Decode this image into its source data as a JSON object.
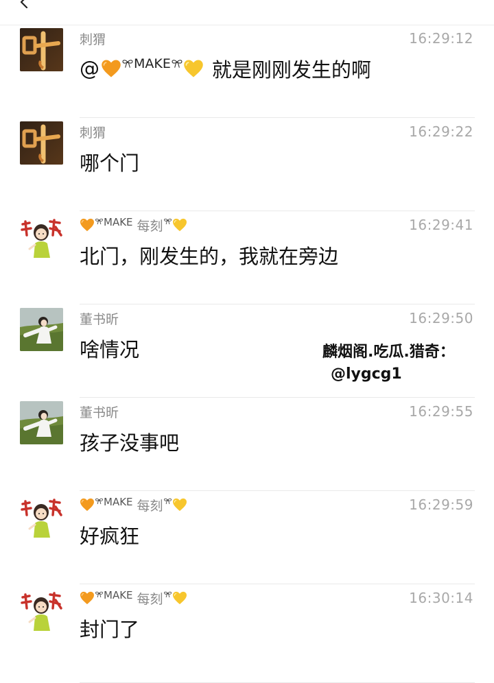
{
  "watermark": {
    "line1": "麟烟阁.吃瓜.猎奇：",
    "line2": "@lygcg1"
  },
  "colors": {
    "orange_heart": "#f39a1e",
    "yellow_heart": "#f7c62d",
    "time_gray": "#a8a8a8",
    "name_gray": "#8a8a8a"
  },
  "messages": [
    {
      "sender": "刺猬",
      "avatar": "calligraphy-ye-avatar",
      "time": "16:29:12",
      "mention_prefix": "@",
      "mention_name": "MAKE",
      "text": "就是刚刚发生的啊"
    },
    {
      "sender": "刺猬",
      "avatar": "calligraphy-ye-avatar",
      "time": "16:29:22",
      "text": "哪个门"
    },
    {
      "sender_name": "MAKE",
      "sender_suffix": "每刻",
      "avatar": "cartoon-girl-avatar",
      "time": "16:29:41",
      "text": "北门，刚发生的，我就在旁边"
    },
    {
      "sender": "董书昕",
      "avatar": "anime-girl-field-avatar",
      "time": "16:29:50",
      "text": "啥情况"
    },
    {
      "sender": "董书昕",
      "avatar": "anime-girl-field-avatar",
      "time": "16:29:55",
      "text": "孩子没事吧"
    },
    {
      "sender_name": "MAKE",
      "sender_suffix": "每刻",
      "avatar": "cartoon-girl-avatar",
      "time": "16:29:59",
      "text": "好疯狂"
    },
    {
      "sender_name": "MAKE",
      "sender_suffix": "每刻",
      "avatar": "cartoon-girl-avatar",
      "time": "16:30:14",
      "text": "封门了"
    }
  ]
}
